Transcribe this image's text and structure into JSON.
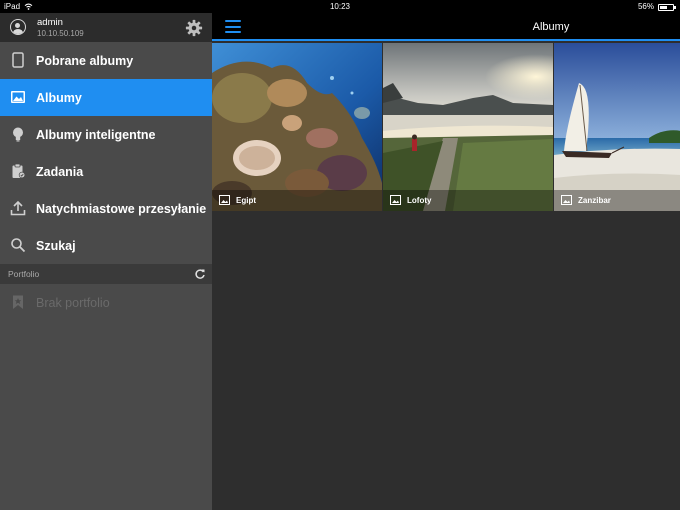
{
  "status_bar": {
    "device": "iPad",
    "time": "10:23",
    "battery": "56%",
    "battery_level": 0.56
  },
  "sidebar": {
    "user": {
      "name": "admin",
      "ip": "10.10.50.109"
    },
    "items": [
      {
        "label": "Pobrane albumy",
        "icon": "tablet-icon",
        "active": false
      },
      {
        "label": "Albumy",
        "icon": "photo-album-icon",
        "active": true
      },
      {
        "label": "Albumy inteligentne",
        "icon": "lightbulb-icon",
        "active": false
      },
      {
        "label": "Zadania",
        "icon": "clipboard-icon",
        "active": false
      },
      {
        "label": "Natychmiastowe przesyłanie",
        "icon": "upload-icon",
        "active": false
      },
      {
        "label": "Szukaj",
        "icon": "search-icon",
        "active": false
      }
    ],
    "section": {
      "label": "Portfolio"
    },
    "portfolio_empty": "Brak portfolio"
  },
  "main": {
    "title": "Albumy",
    "albums": [
      {
        "name": "Egipt"
      },
      {
        "name": "Lofoty"
      },
      {
        "name": "Zanzibar"
      }
    ]
  },
  "colors": {
    "accent": "#1f8ef1",
    "sidebar": "#4a4a4a",
    "content": "#2e2e2e"
  }
}
